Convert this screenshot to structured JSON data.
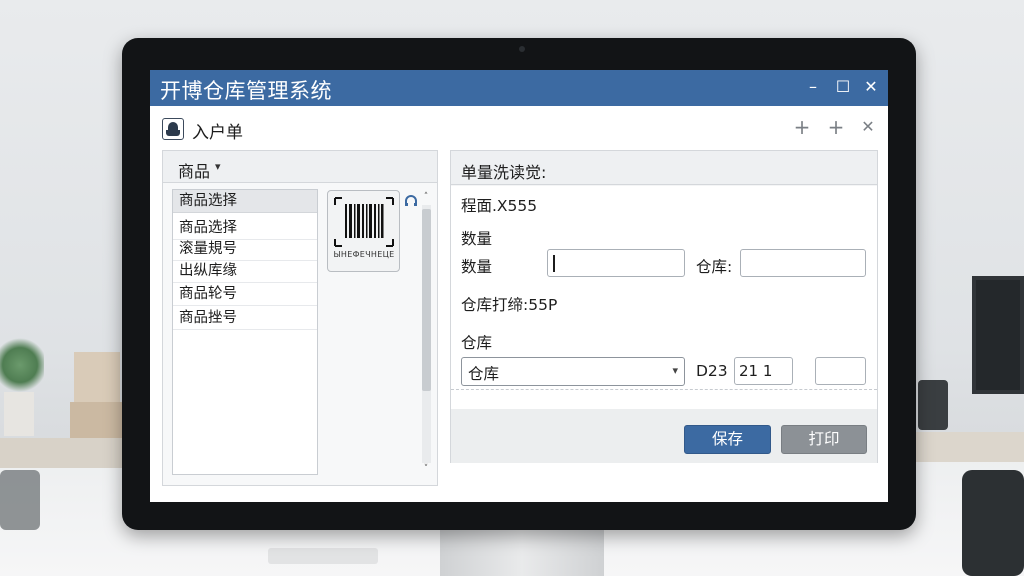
{
  "window": {
    "title": "开博仓库管理系统",
    "minimize": "–",
    "maximize": "☐",
    "close": "✕"
  },
  "toolbar": {
    "doc_title": "入户单",
    "add1": "+",
    "add2": "+",
    "close": "✕"
  },
  "left_panel": {
    "header": "商品",
    "caret": "▾",
    "list_items": [
      "商品选择",
      "商品选择",
      "滚量規号",
      "出纵库缘",
      "商品轮号",
      "商品挫号"
    ],
    "barcode_caption": "ЫНЕФЕЧНЕЦЕ",
    "scroll_up": "˄",
    "scroll_down": "˅"
  },
  "right_panel": {
    "header": "单量洗读觉:",
    "code_label": "程面.X555",
    "qty_heading": "数量",
    "qty_label": "数量",
    "warehouse_label": "仓库:",
    "warehouse_ref_label": "仓库打缔:55P",
    "warehouse_heading": "仓库",
    "warehouse_select": "仓库",
    "select_arrow": "▾",
    "slot_label": "D23",
    "slot_value": "21 1",
    "save_label": "保存",
    "print_label": "打印"
  },
  "colors": {
    "titlebar": "#3c6aa2",
    "save_button": "#3c6aa2",
    "print_button": "#8c9196"
  }
}
